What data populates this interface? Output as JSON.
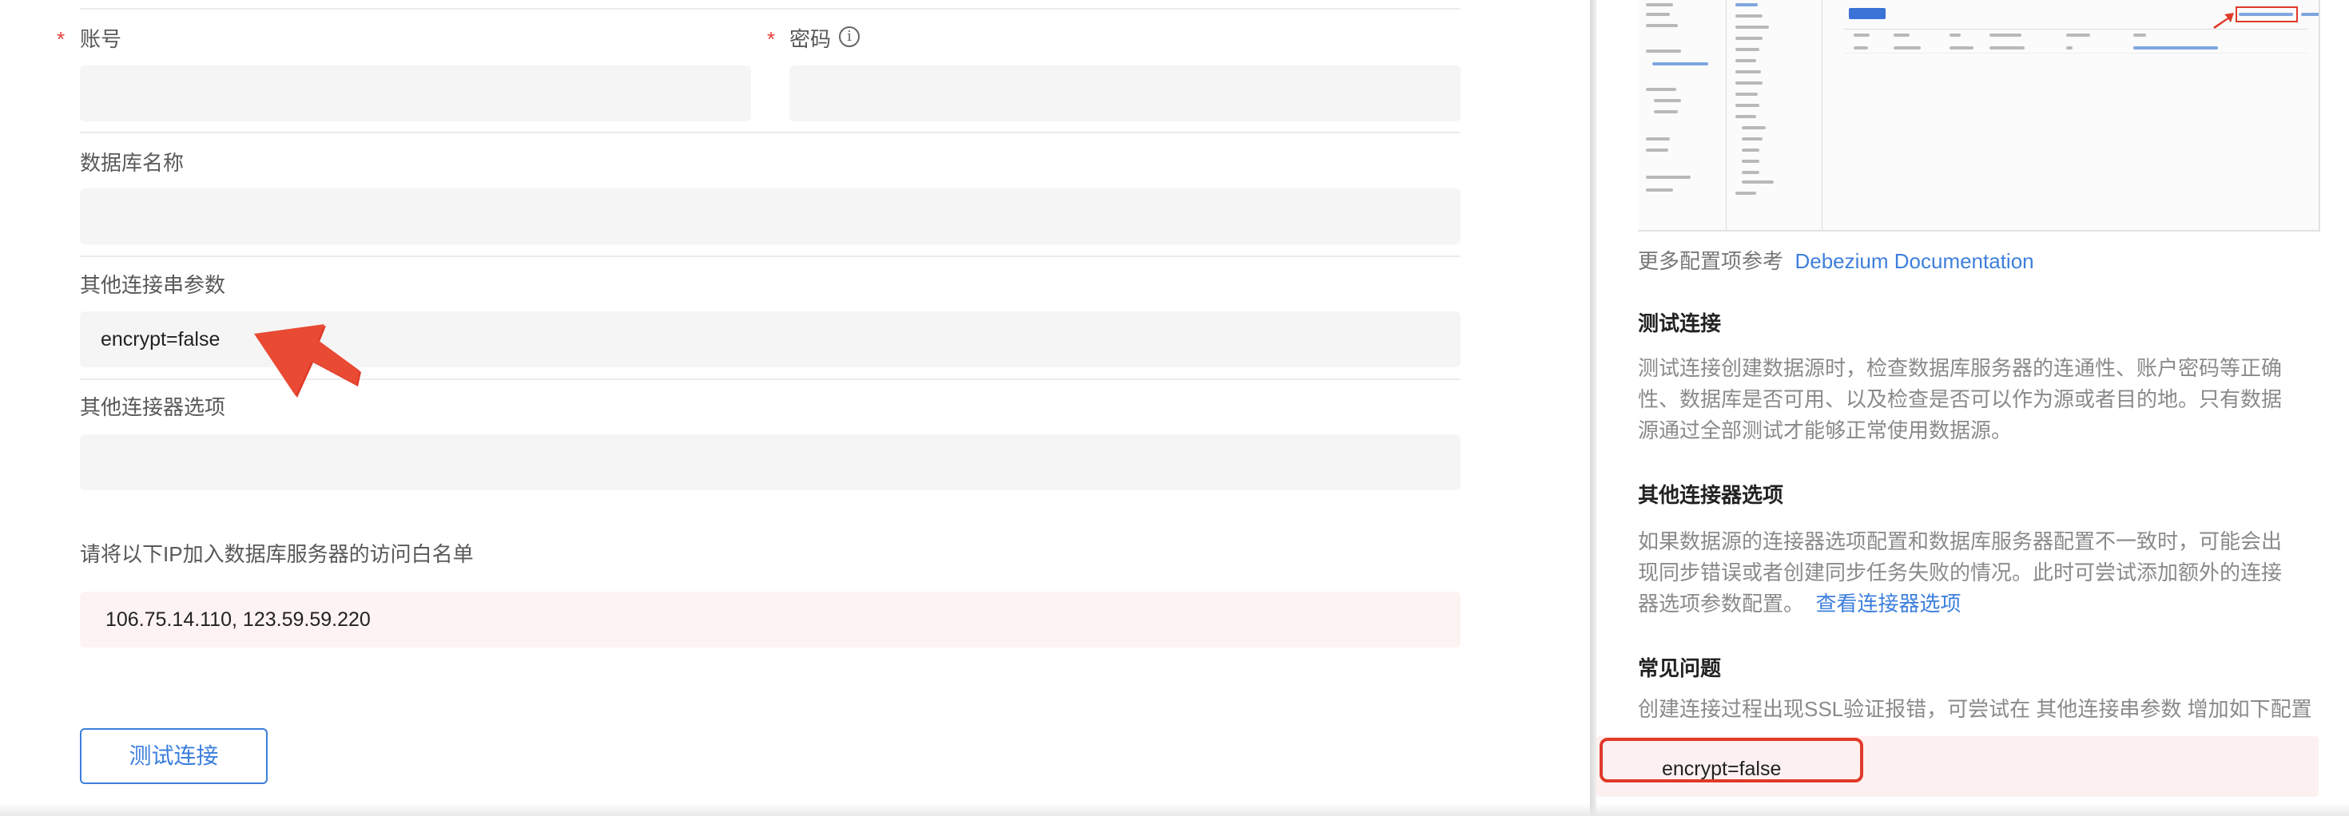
{
  "form": {
    "account_label": "账号",
    "password_label": "密码",
    "required_mark": "*",
    "info_glyph": "i",
    "account_value": "",
    "password_value": "",
    "dbname_label": "数据库名称",
    "dbname_value": "",
    "conn_params_label": "其他连接串参数",
    "conn_params_value": "encrypt=false",
    "connector_opts_label": "其他连接器选项",
    "connector_opts_value": "",
    "whitelist_label": "请将以下IP加入数据库服务器的访问白名单",
    "whitelist_ips": "106.75.14.110, 123.59.59.220",
    "test_button": "测试连接"
  },
  "help": {
    "more_config_text": "更多配置项参考",
    "more_config_link": "Debezium Documentation",
    "test_title": "测试连接",
    "test_desc": "测试连接创建数据源时，检查数据库服务器的连通性、账户密码等正确性、数据库是否可用、以及检查是否可以作为源或者目的地。只有数据源通过全部测试才能够正常使用数据源。",
    "connector_title": "其他连接器选项",
    "connector_desc": "如果数据源的连接器选项配置和数据库服务器配置不一致时，可能会出现同步错误或者创建同步任务失败的情况。此时可尝试添加额外的连接器选项参数配置。",
    "connector_link": "查看连接器选项",
    "faq_title": "常见问题",
    "faq_desc": "创建连接过程出现SSL验证报错，可尝试在 其他连接串参数 增加如下配置",
    "faq_code": "encrypt=false"
  },
  "colors": {
    "accent": "#3d7fdc",
    "annotation_red": "#e03a2a",
    "input_bg": "#f5f5f5",
    "ip_bg": "#fdf3f2"
  },
  "icons": [
    "info-icon",
    "red-arrow-annotation",
    "red-highlight-box"
  ]
}
